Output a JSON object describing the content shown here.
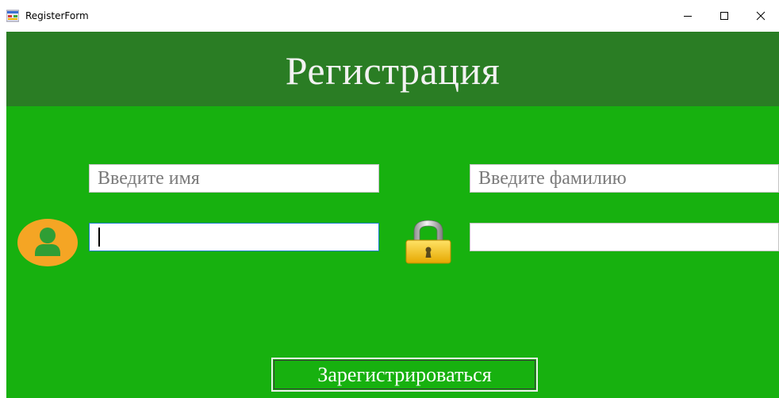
{
  "window": {
    "title": "RegisterForm",
    "icons": {
      "app": "form-app-icon",
      "minimize": "minimize-icon",
      "maximize": "maximize-icon",
      "close": "close-icon"
    }
  },
  "header": {
    "title": "Регистрация"
  },
  "form": {
    "name_placeholder": "Введите имя",
    "surname_placeholder": "Введите фамилию",
    "login_value": "",
    "password_value": "",
    "user_icon": "user-icon",
    "lock_icon": "lock-icon"
  },
  "register_button": {
    "label": "Зарегистрироваться"
  },
  "colors": {
    "header_bg": "#2a7d24",
    "body_bg": "#17b10f",
    "user_icon": "#f5a524",
    "lock_body": "#f2c21b"
  }
}
